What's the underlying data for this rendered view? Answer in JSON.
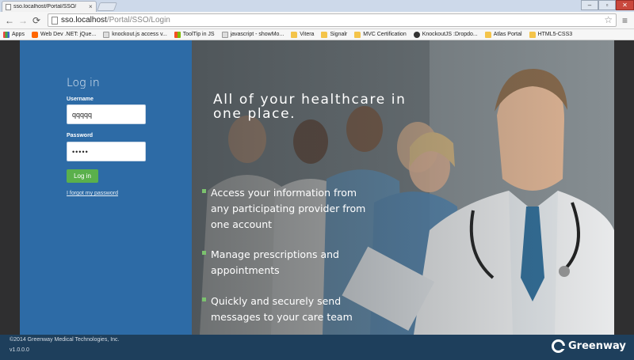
{
  "browser": {
    "tab_title": "sso.localhost/Portal/SSO/",
    "url_host": "sso.localhost",
    "url_path": "/Portal/SSO/Login",
    "bookmarks": [
      {
        "label": "Apps",
        "icon": "apps-icon"
      },
      {
        "label": "Web Dev .NET: jQue...",
        "icon": "blogger-icon"
      },
      {
        "label": "knockout.js access v...",
        "icon": "page-icon"
      },
      {
        "label": "ToolTip in JS",
        "icon": "microsoft-icon"
      },
      {
        "label": "javascript - showMo...",
        "icon": "page-icon"
      },
      {
        "label": "Vitera",
        "icon": "folder-icon"
      },
      {
        "label": "Signalr",
        "icon": "folder-icon"
      },
      {
        "label": "MVC Certification",
        "icon": "folder-icon"
      },
      {
        "label": "KnockoutJS :Dropdo...",
        "icon": "github-icon"
      },
      {
        "label": "Atlas Portal",
        "icon": "folder-icon"
      },
      {
        "label": "HTML5-CSS3",
        "icon": "folder-icon"
      }
    ]
  },
  "login": {
    "title": "Log in",
    "username_label": "Username",
    "username_value": "qqqqq",
    "password_label": "Password",
    "password_value": "•••••",
    "button_label": "Log in",
    "forgot_link": "I forgot my password"
  },
  "hero": {
    "headline": "All of your healthcare in one place.",
    "bullets": [
      "Access your information from any participating provider from one account",
      "Manage prescriptions and appointments",
      "Quickly and securely send messages to your care team"
    ]
  },
  "footer": {
    "copyright": "©2014 Greenway Medical Technologies, Inc.",
    "version": "v1.0.0.0",
    "brand": "Greenway"
  },
  "colors": {
    "login_panel": "#2d6ba6",
    "login_button": "#5ab04c",
    "footer": "#1e3f5c"
  }
}
